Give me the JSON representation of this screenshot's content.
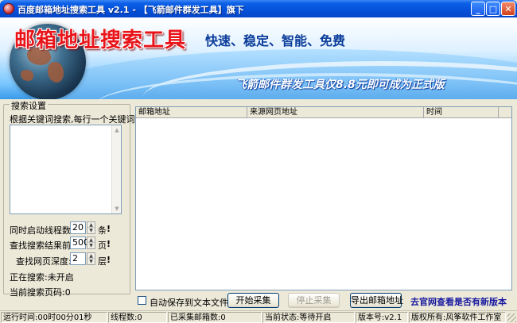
{
  "window": {
    "title": "百度邮箱地址搜索工具 v2.1 - 【飞箭邮件群发工具】旗下",
    "min_label": "_",
    "max_label": "□",
    "close_label": "✕"
  },
  "banner": {
    "headline": "邮箱地址搜索工具",
    "slogan": "快速、稳定、智能、免费",
    "promo": "飞箭邮件群发工具仅8.8元即可成为正式版"
  },
  "search_settings": {
    "legend": "搜索设置",
    "keyword_label": "根据关键词搜索,每行一个关键词:",
    "keywords_value": "",
    "threads_label": "同时启动线程数:",
    "threads_value": "20",
    "threads_unit": "条",
    "results_label": "查找搜索结果前",
    "results_value": "500",
    "results_unit": "页",
    "depth_label": "查找网页深度:",
    "depth_value": "2",
    "depth_unit": "层",
    "current_search_label": "正在搜索:未开启",
    "current_page_label": "当前搜索页码:0",
    "spin_up": "▲",
    "spin_down": "▼",
    "excl": "!"
  },
  "results_table": {
    "columns": [
      "邮箱地址",
      "来源网页地址",
      "时间"
    ],
    "rows": []
  },
  "actions": {
    "autosave_label": "自动保存到文本文件",
    "start_label": "开始采集",
    "stop_label": "停止采集",
    "export_label": "导出邮箱地址",
    "check_update_label": "去官网查看是否有新版本"
  },
  "statusbar": {
    "runtime": "运行时间:00时00分01秒",
    "threads": "线程数:0",
    "collected": "已采集邮箱数:0",
    "state": "当前状态:等待开启",
    "version": "版本号:v2.1",
    "copyright": "版权所有:风筝软件工作室"
  },
  "colors": {
    "titlebar": "#0650d9",
    "headline": "#e8141a",
    "slogan": "#0a3c9a",
    "link": "#1818a0"
  }
}
